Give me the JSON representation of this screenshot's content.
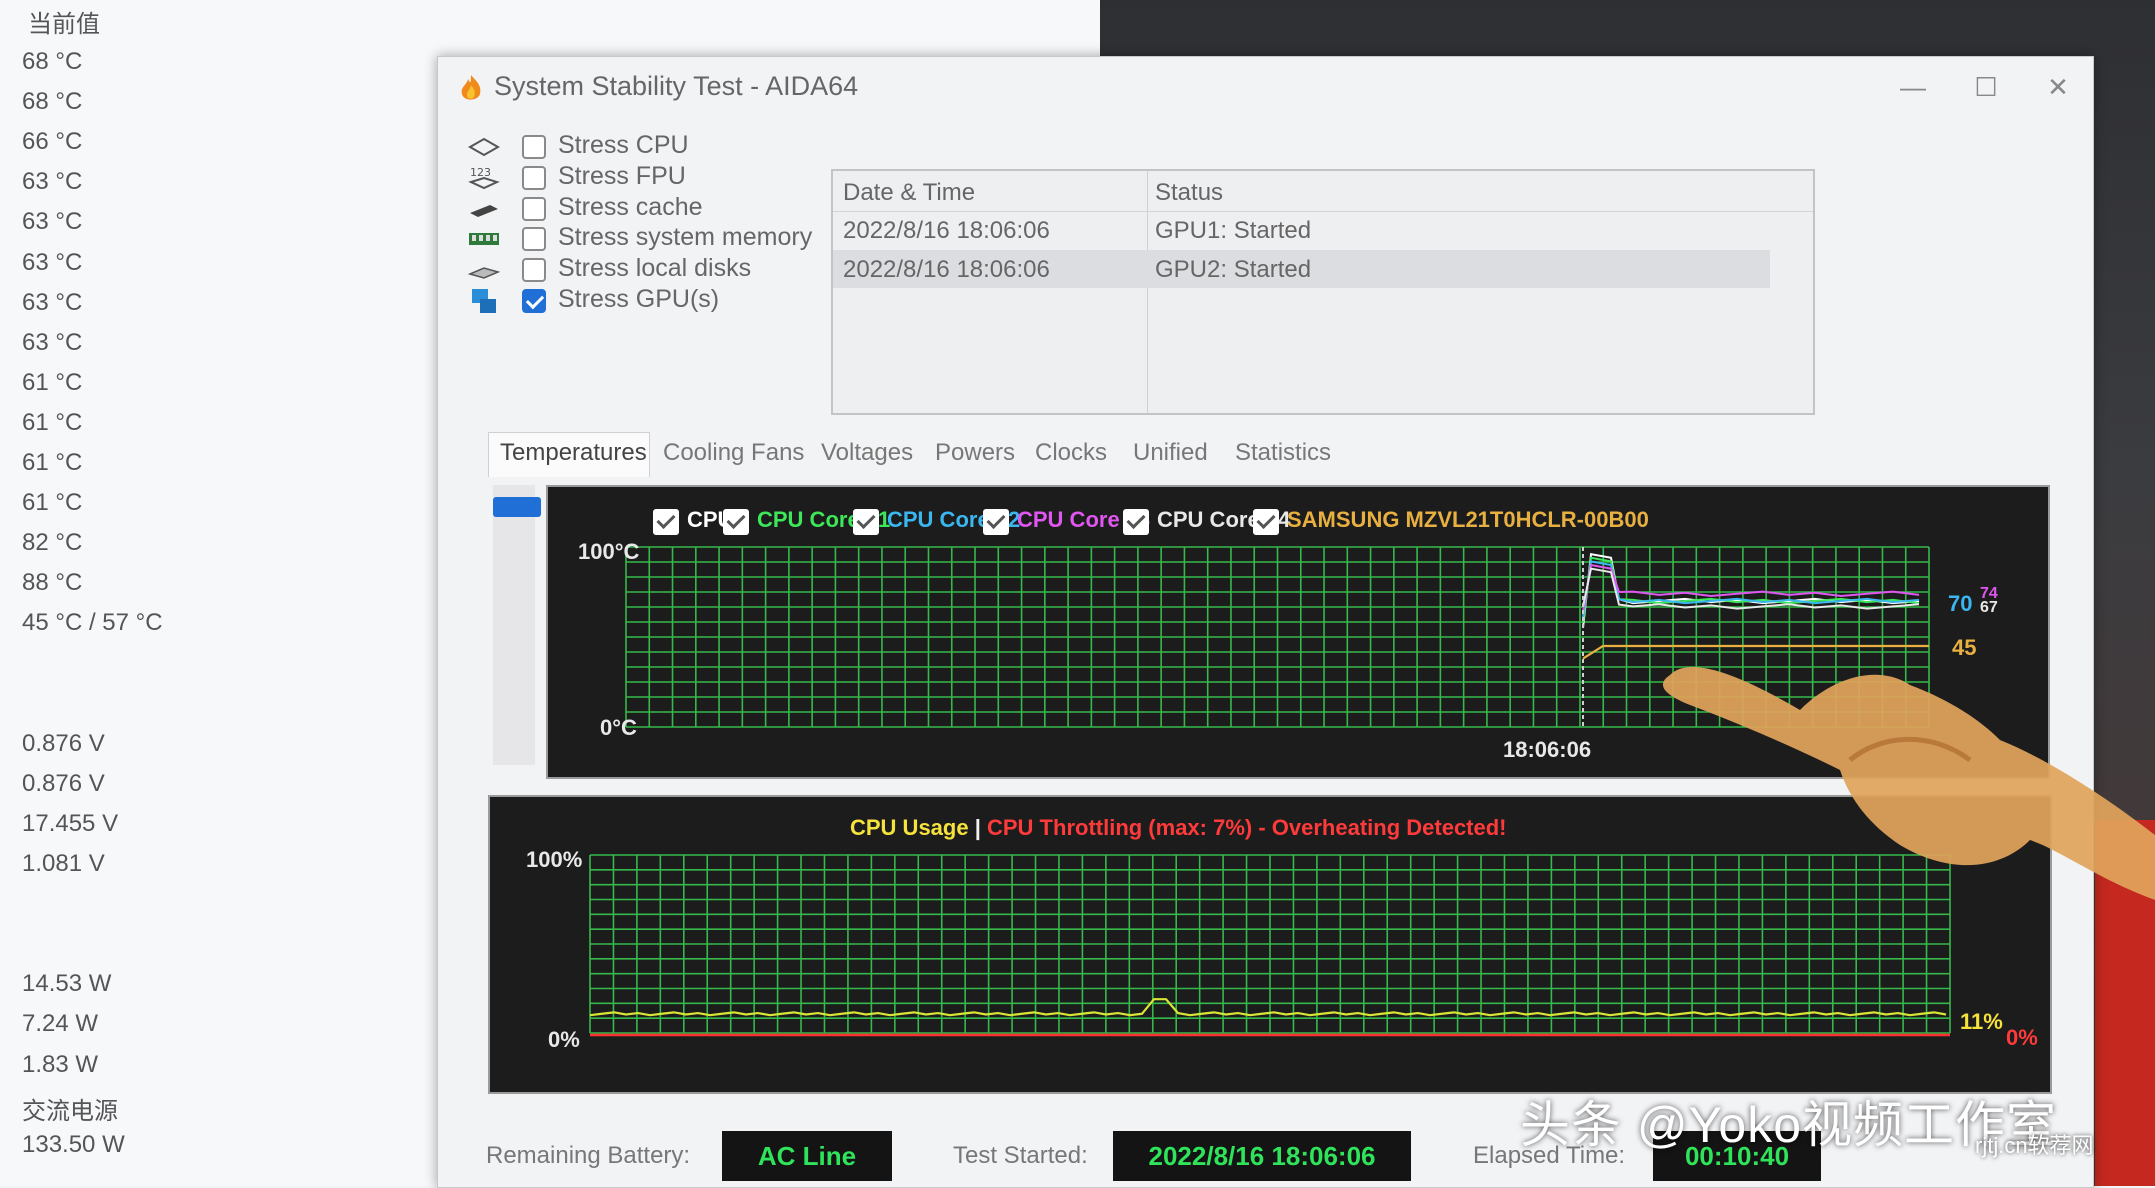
{
  "background": {
    "header": "当前值",
    "values": [
      "68 °C",
      "68 °C",
      "66 °C",
      "63 °C",
      "63 °C",
      "63 °C",
      "63 °C",
      "63 °C",
      "61 °C",
      "61 °C",
      "61 °C",
      "61 °C",
      "82 °C",
      "88 °C",
      "45 °C / 57 °C",
      "",
      "",
      "0.876 V",
      "0.876 V",
      "17.455 V",
      "1.081 V",
      "",
      "",
      "14.53 W",
      "7.24 W",
      "1.83 W",
      "交流电源",
      "133.50 W"
    ]
  },
  "window": {
    "title": "System Stability Test - AIDA64",
    "minimize": "—",
    "maximize": "☐",
    "close": "✕"
  },
  "stress": [
    {
      "label": "Stress CPU",
      "checked": false,
      "icon": "cpu-chip-icon"
    },
    {
      "label": "Stress FPU",
      "checked": false,
      "icon": "fpu-123-icon"
    },
    {
      "label": "Stress cache",
      "checked": false,
      "icon": "cache-icon"
    },
    {
      "label": "Stress system memory",
      "checked": false,
      "icon": "memory-module-icon"
    },
    {
      "label": "Stress local disks",
      "checked": false,
      "icon": "disk-icon"
    },
    {
      "label": "Stress GPU(s)",
      "checked": true,
      "icon": "gpu-icon"
    }
  ],
  "log": {
    "headers": [
      "Date & Time",
      "Status"
    ],
    "rows": [
      [
        "2022/8/16 18:06:06",
        "GPU1: Started"
      ],
      [
        "2022/8/16 18:06:06",
        "GPU2: Started"
      ]
    ]
  },
  "tabs": [
    "Temperatures",
    "Cooling Fans",
    "Voltages",
    "Powers",
    "Clocks",
    "Unified",
    "Statistics"
  ],
  "temp_legend": [
    {
      "label": "CPU",
      "color": "#ffffff"
    },
    {
      "label": "CPU Core #1",
      "color": "#3ce85a"
    },
    {
      "label": "CPU Core #2",
      "color": "#3ab7f0"
    },
    {
      "label": "CPU Core #3",
      "color": "#e056f0"
    },
    {
      "label": "CPU Core #4",
      "color": "#e8e8e8"
    },
    {
      "label": "SAMSUNG MZVL21T0HCLR-00B00",
      "color": "#e8b040"
    }
  ],
  "temp_axis": {
    "top": "100°C",
    "bottom": "0°C",
    "time": "18:06:06"
  },
  "temp_readouts": {
    "main": "70",
    "hi1": "74",
    "hi2": "67",
    "ssd": "45"
  },
  "cpu_chart": {
    "title_a": "CPU Usage",
    "sep": "|",
    "title_b": "CPU Throttling (max: 7%) - Overheating Detected!",
    "top": "100%",
    "bottom": "0%",
    "usage_readout": "11%",
    "throttle_readout": "0%"
  },
  "status": {
    "battery_label": "Remaining Battery:",
    "battery_value": "AC Line",
    "started_label": "Test Started:",
    "started_value": "2022/8/16 18:06:06",
    "elapsed_label": "Elapsed Time:",
    "elapsed_value": "00:10:40"
  },
  "watermark": {
    "main": "头条 @Yoko视频工作室",
    "site": "rjtj.cn软荐网"
  },
  "chart_data": [
    {
      "type": "line",
      "title": "",
      "ylim": [
        0,
        100
      ],
      "ylabel_top": "100°C",
      "ylabel_bottom": "0°C",
      "x_marker": "18:06:06",
      "series": [
        {
          "name": "CPU",
          "current": 70
        },
        {
          "name": "CPU Core #1",
          "current": 70
        },
        {
          "name": "CPU Core #2",
          "current": 70
        },
        {
          "name": "CPU Core #3",
          "current": 74
        },
        {
          "name": "CPU Core #4",
          "current": 67
        },
        {
          "name": "SAMSUNG MZVL21T0HCLR-00B00",
          "current": 45
        }
      ]
    },
    {
      "type": "line",
      "title": "CPU Usage | CPU Throttling (max: 7%) - Overheating Detected!",
      "ylim": [
        0,
        100
      ],
      "series": [
        {
          "name": "CPU Usage",
          "current": 11
        },
        {
          "name": "CPU Throttling",
          "current": 0
        }
      ]
    }
  ]
}
